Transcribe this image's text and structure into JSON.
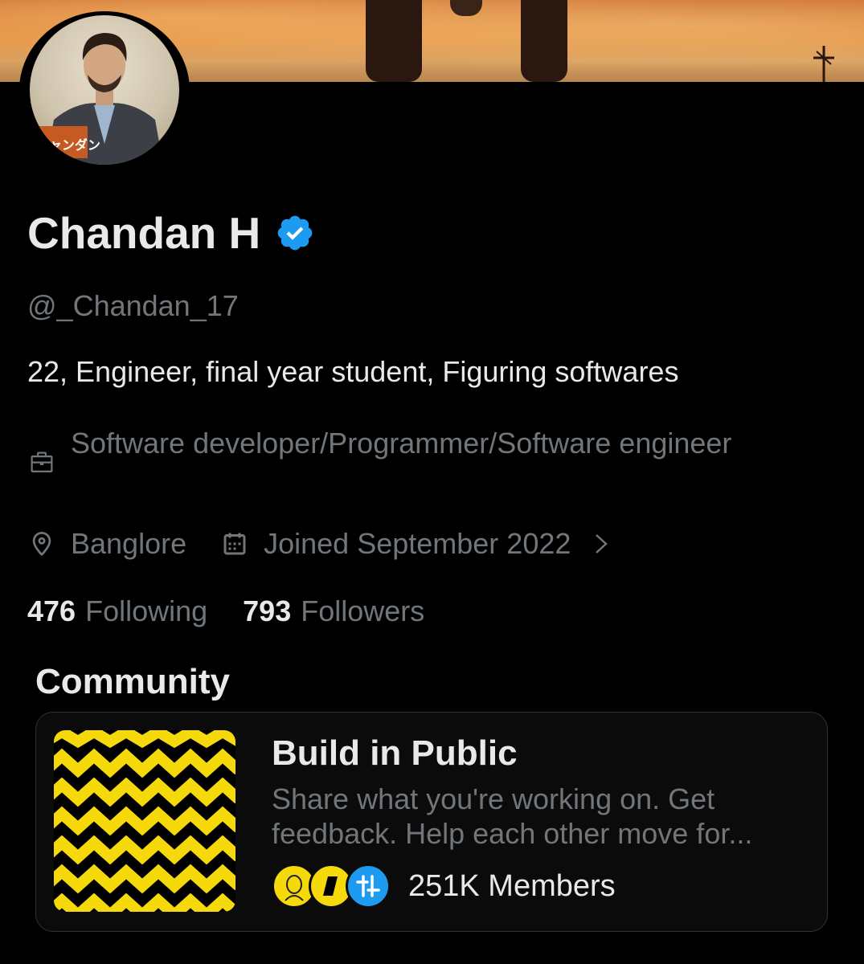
{
  "profile": {
    "name": "Chandan H",
    "handle": "@_Chandan_17",
    "bio": "22, Engineer, final year student, Figuring softwares",
    "job": "Software developer/Programmer/Software engineer",
    "location": "Banglore",
    "joined": "Joined September 2022",
    "avatar_text": "チャンダン",
    "following_count": "476",
    "following_label": "Following",
    "followers_count": "793",
    "followers_label": "Followers",
    "verified_color": "#1d9bf0"
  },
  "icons": {
    "job": "briefcase-icon",
    "location": "location-pin-icon",
    "joined": "calendar-icon",
    "more": "chevron-right-icon",
    "verified": "verified-badge-icon"
  },
  "community": {
    "section_title": "Community",
    "card": {
      "title": "Build in Public",
      "description": "Share what you're working on. Get feedback. Help each other move for...",
      "members": "251K Members",
      "image_colors": [
        "#f5d90a",
        "#000000"
      ]
    }
  }
}
